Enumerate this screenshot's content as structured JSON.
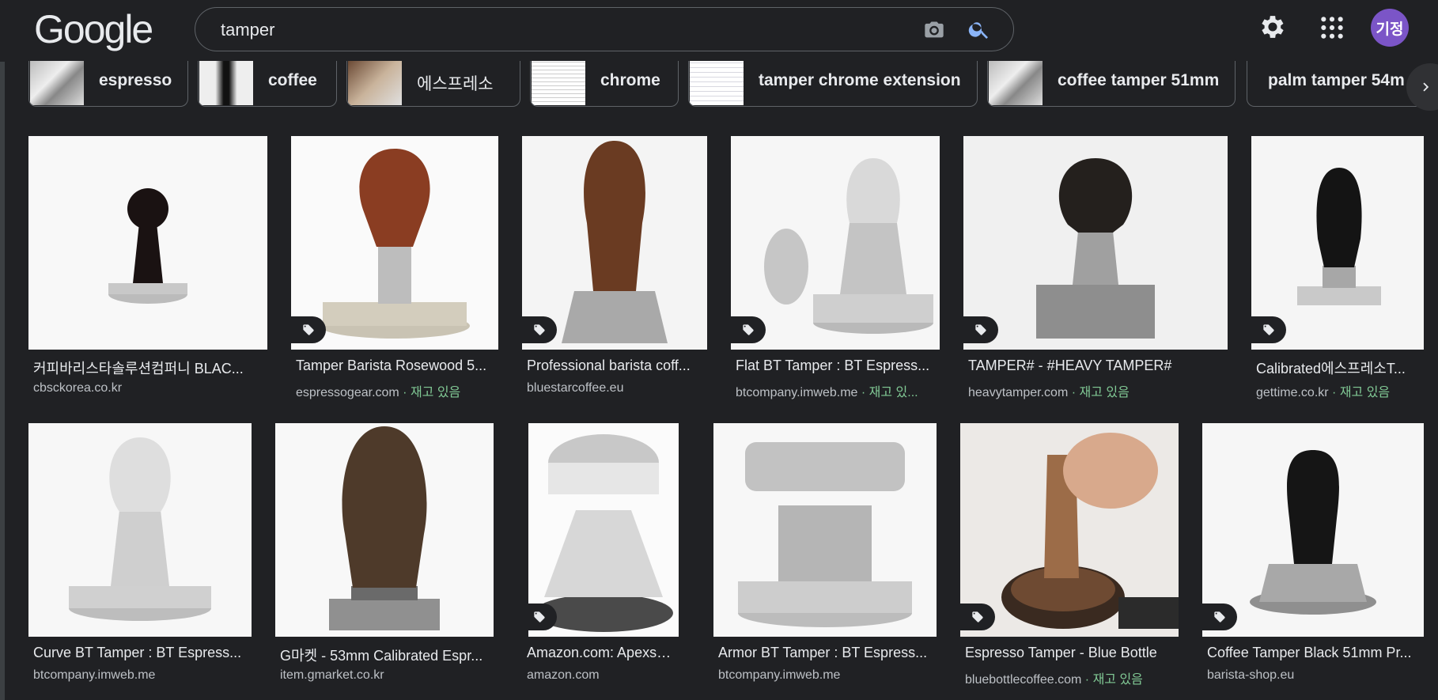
{
  "header": {
    "logo": "Google",
    "search_value": "tamper",
    "avatar_text": "기정"
  },
  "chips": [
    {
      "label": "espresso"
    },
    {
      "label": "coffee"
    },
    {
      "label": "에스프레소"
    },
    {
      "label": "chrome"
    },
    {
      "label": "tamper chrome extension"
    },
    {
      "label": "coffee tamper 51mm"
    },
    {
      "label": "palm tamper 54m"
    }
  ],
  "results": [
    {
      "title": "커피바리스타솔루션컴퍼니 BLAC...",
      "source": "cbsckorea.co.kr",
      "stock": ""
    },
    {
      "title": "Tamper Barista Rosewood 5...",
      "source": "espressogear.com",
      "stock": " · 재고 있음"
    },
    {
      "title": "Professional barista coff...",
      "source": "bluestarcoffee.eu",
      "stock": ""
    },
    {
      "title": "Flat BT Tamper : BT Espress...",
      "source": "btcompany.imweb.me",
      "stock": " · 재고 있..."
    },
    {
      "title": "TAMPER# - #HEAVY TAMPER#",
      "source": "heavytamper.com",
      "stock": " · 재고 있음"
    },
    {
      "title": "Calibrated에스프레소T...",
      "source": "gettime.co.kr",
      "stock": " · 재고 있음"
    },
    {
      "title": "Curve BT Tamper : BT Espress...",
      "source": "btcompany.imweb.me",
      "stock": ""
    },
    {
      "title": "G마켓 - 53mm Calibrated Espr...",
      "source": "item.gmarket.co.kr",
      "stock": ""
    },
    {
      "title": "Amazon.com: Apexsto...",
      "source": "amazon.com",
      "stock": ""
    },
    {
      "title": "Armor BT Tamper : BT Espress...",
      "source": "btcompany.imweb.me",
      "stock": ""
    },
    {
      "title": "Espresso Tamper - Blue Bottle",
      "source": "bluebottlecoffee.com",
      "stock": " · 재고 있음"
    },
    {
      "title": "Coffee Tamper Black 51mm Pr...",
      "source": "barista-shop.eu",
      "stock": ""
    }
  ]
}
